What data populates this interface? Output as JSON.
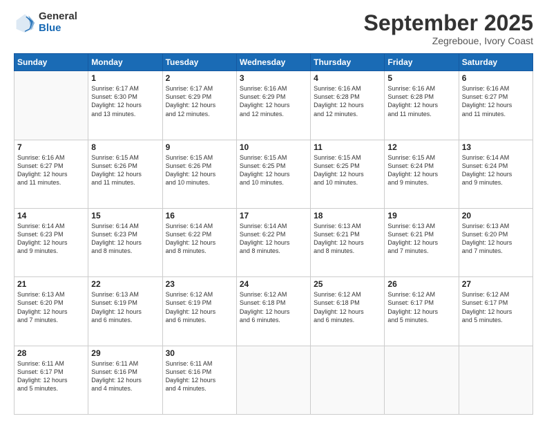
{
  "logo": {
    "general": "General",
    "blue": "Blue"
  },
  "header": {
    "month": "September 2025",
    "location": "Zegreboue, Ivory Coast"
  },
  "weekdays": [
    "Sunday",
    "Monday",
    "Tuesday",
    "Wednesday",
    "Thursday",
    "Friday",
    "Saturday"
  ],
  "weeks": [
    [
      {
        "day": "",
        "info": ""
      },
      {
        "day": "1",
        "info": "Sunrise: 6:17 AM\nSunset: 6:30 PM\nDaylight: 12 hours\nand 13 minutes."
      },
      {
        "day": "2",
        "info": "Sunrise: 6:17 AM\nSunset: 6:29 PM\nDaylight: 12 hours\nand 12 minutes."
      },
      {
        "day": "3",
        "info": "Sunrise: 6:16 AM\nSunset: 6:29 PM\nDaylight: 12 hours\nand 12 minutes."
      },
      {
        "day": "4",
        "info": "Sunrise: 6:16 AM\nSunset: 6:28 PM\nDaylight: 12 hours\nand 12 minutes."
      },
      {
        "day": "5",
        "info": "Sunrise: 6:16 AM\nSunset: 6:28 PM\nDaylight: 12 hours\nand 11 minutes."
      },
      {
        "day": "6",
        "info": "Sunrise: 6:16 AM\nSunset: 6:27 PM\nDaylight: 12 hours\nand 11 minutes."
      }
    ],
    [
      {
        "day": "7",
        "info": "Sunrise: 6:16 AM\nSunset: 6:27 PM\nDaylight: 12 hours\nand 11 minutes."
      },
      {
        "day": "8",
        "info": "Sunrise: 6:15 AM\nSunset: 6:26 PM\nDaylight: 12 hours\nand 11 minutes."
      },
      {
        "day": "9",
        "info": "Sunrise: 6:15 AM\nSunset: 6:26 PM\nDaylight: 12 hours\nand 10 minutes."
      },
      {
        "day": "10",
        "info": "Sunrise: 6:15 AM\nSunset: 6:25 PM\nDaylight: 12 hours\nand 10 minutes."
      },
      {
        "day": "11",
        "info": "Sunrise: 6:15 AM\nSunset: 6:25 PM\nDaylight: 12 hours\nand 10 minutes."
      },
      {
        "day": "12",
        "info": "Sunrise: 6:15 AM\nSunset: 6:24 PM\nDaylight: 12 hours\nand 9 minutes."
      },
      {
        "day": "13",
        "info": "Sunrise: 6:14 AM\nSunset: 6:24 PM\nDaylight: 12 hours\nand 9 minutes."
      }
    ],
    [
      {
        "day": "14",
        "info": "Sunrise: 6:14 AM\nSunset: 6:23 PM\nDaylight: 12 hours\nand 9 minutes."
      },
      {
        "day": "15",
        "info": "Sunrise: 6:14 AM\nSunset: 6:23 PM\nDaylight: 12 hours\nand 8 minutes."
      },
      {
        "day": "16",
        "info": "Sunrise: 6:14 AM\nSunset: 6:22 PM\nDaylight: 12 hours\nand 8 minutes."
      },
      {
        "day": "17",
        "info": "Sunrise: 6:14 AM\nSunset: 6:22 PM\nDaylight: 12 hours\nand 8 minutes."
      },
      {
        "day": "18",
        "info": "Sunrise: 6:13 AM\nSunset: 6:21 PM\nDaylight: 12 hours\nand 8 minutes."
      },
      {
        "day": "19",
        "info": "Sunrise: 6:13 AM\nSunset: 6:21 PM\nDaylight: 12 hours\nand 7 minutes."
      },
      {
        "day": "20",
        "info": "Sunrise: 6:13 AM\nSunset: 6:20 PM\nDaylight: 12 hours\nand 7 minutes."
      }
    ],
    [
      {
        "day": "21",
        "info": "Sunrise: 6:13 AM\nSunset: 6:20 PM\nDaylight: 12 hours\nand 7 minutes."
      },
      {
        "day": "22",
        "info": "Sunrise: 6:13 AM\nSunset: 6:19 PM\nDaylight: 12 hours\nand 6 minutes."
      },
      {
        "day": "23",
        "info": "Sunrise: 6:12 AM\nSunset: 6:19 PM\nDaylight: 12 hours\nand 6 minutes."
      },
      {
        "day": "24",
        "info": "Sunrise: 6:12 AM\nSunset: 6:18 PM\nDaylight: 12 hours\nand 6 minutes."
      },
      {
        "day": "25",
        "info": "Sunrise: 6:12 AM\nSunset: 6:18 PM\nDaylight: 12 hours\nand 6 minutes."
      },
      {
        "day": "26",
        "info": "Sunrise: 6:12 AM\nSunset: 6:17 PM\nDaylight: 12 hours\nand 5 minutes."
      },
      {
        "day": "27",
        "info": "Sunrise: 6:12 AM\nSunset: 6:17 PM\nDaylight: 12 hours\nand 5 minutes."
      }
    ],
    [
      {
        "day": "28",
        "info": "Sunrise: 6:11 AM\nSunset: 6:17 PM\nDaylight: 12 hours\nand 5 minutes."
      },
      {
        "day": "29",
        "info": "Sunrise: 6:11 AM\nSunset: 6:16 PM\nDaylight: 12 hours\nand 4 minutes."
      },
      {
        "day": "30",
        "info": "Sunrise: 6:11 AM\nSunset: 6:16 PM\nDaylight: 12 hours\nand 4 minutes."
      },
      {
        "day": "",
        "info": ""
      },
      {
        "day": "",
        "info": ""
      },
      {
        "day": "",
        "info": ""
      },
      {
        "day": "",
        "info": ""
      }
    ]
  ]
}
